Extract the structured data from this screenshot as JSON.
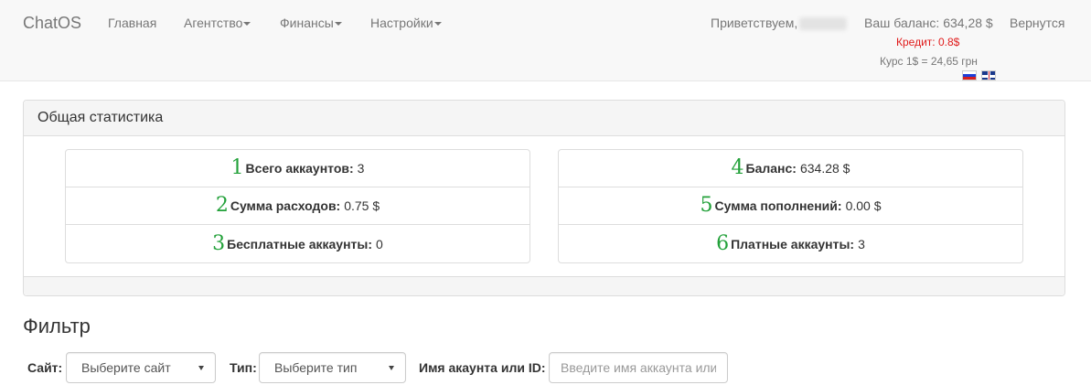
{
  "navbar": {
    "brand": "ChatOS",
    "items": [
      {
        "label": "Главная",
        "dropdown": false
      },
      {
        "label": "Агентство",
        "dropdown": true
      },
      {
        "label": "Финансы",
        "dropdown": true
      },
      {
        "label": "Настройки",
        "dropdown": true
      }
    ],
    "greeting": "Приветствуем,",
    "balance": "Ваш баланс: 634,28 $",
    "return": "Вернутся",
    "credit": "Кредит: 0.8$",
    "rate": "Курс 1$ = 24,65 грн"
  },
  "stats": {
    "title": "Общая статистика",
    "left": [
      {
        "num": "1",
        "label": "Всего аккаунтов:",
        "value": "3"
      },
      {
        "num": "2",
        "label": "Сумма расходов:",
        "value": "0.75 $"
      },
      {
        "num": "3",
        "label": "Бесплатные аккаунты:",
        "value": "0"
      }
    ],
    "right": [
      {
        "num": "4",
        "label": "Баланс:",
        "value": "634.28 $"
      },
      {
        "num": "5",
        "label": "Сумма пополнений:",
        "value": "0.00 $"
      },
      {
        "num": "6",
        "label": "Платные аккаунты:",
        "value": "3"
      }
    ]
  },
  "filter": {
    "title": "Фильтр",
    "site_label": "Сайт:",
    "site_value": "Выберите сайт",
    "type_label": "Тип:",
    "type_value": "Выберите тип",
    "account_label": "Имя акаунта или ID:",
    "account_placeholder": "Введите имя аккаунта или"
  },
  "colors": {
    "credit": "#e01b1b",
    "annotation_numbers": "#23a13a"
  }
}
